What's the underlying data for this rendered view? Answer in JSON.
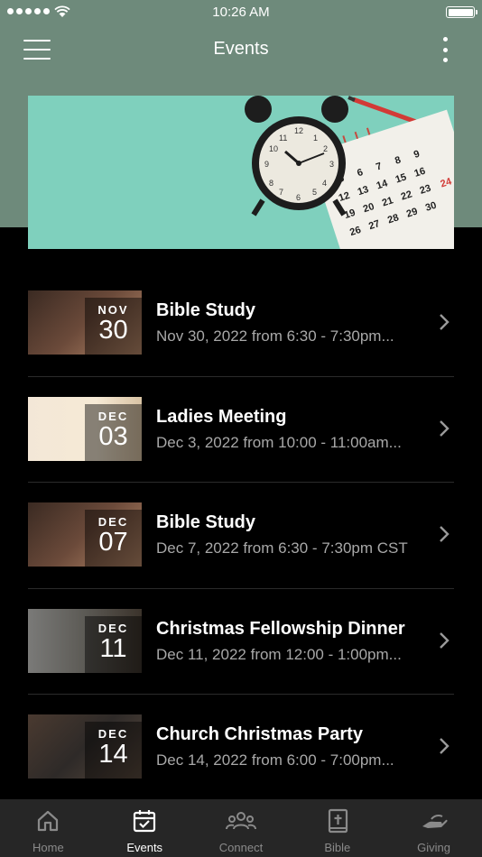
{
  "status_bar": {
    "time": "10:26 AM"
  },
  "nav": {
    "title": "Events"
  },
  "events": [
    {
      "month": "NOV",
      "day": "30",
      "title": "Bible Study",
      "subtitle": "Nov 30, 2022 from 6:30 - 7:30pm..."
    },
    {
      "month": "DEC",
      "day": "03",
      "title": "Ladies Meeting",
      "subtitle": "Dec 3, 2022 from 10:00 - 11:00am..."
    },
    {
      "month": "DEC",
      "day": "07",
      "title": "Bible Study",
      "subtitle": "Dec 7, 2022 from 6:30 - 7:30pm CST"
    },
    {
      "month": "DEC",
      "day": "11",
      "title": "Christmas Fellowship Dinner",
      "subtitle": "Dec 11, 2022 from 12:00 - 1:00pm..."
    },
    {
      "month": "DEC",
      "day": "14",
      "title": "Church Christmas Party",
      "subtitle": "Dec 14, 2022 from 6:00 - 7:00pm..."
    }
  ],
  "tabs": [
    {
      "label": "Home",
      "icon": "home-icon"
    },
    {
      "label": "Events",
      "icon": "calendar-check-icon",
      "active": true
    },
    {
      "label": "Connect",
      "icon": "people-icon"
    },
    {
      "label": "Bible",
      "icon": "bible-icon"
    },
    {
      "label": "Giving",
      "icon": "giving-hand-icon"
    }
  ],
  "colors": {
    "header_bg": "#6e8a7b",
    "banner_bg": "#7fd0bd",
    "tab_bar_bg": "#262626",
    "subtitle": "#a8a8a8"
  }
}
